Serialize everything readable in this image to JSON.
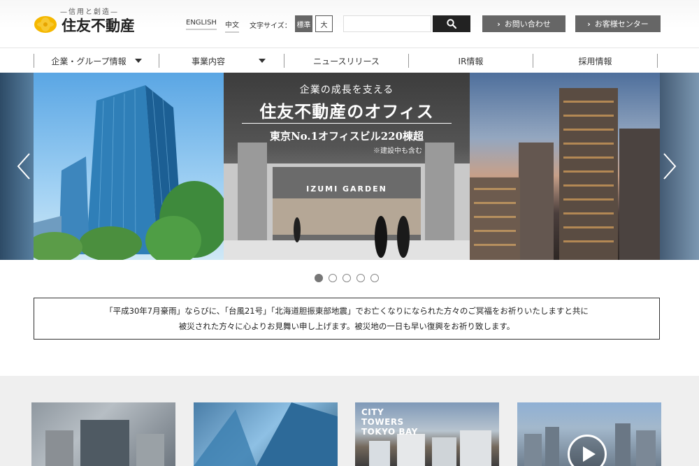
{
  "header": {
    "tagline": "—信用と創造—",
    "logo_text": "住友不動産",
    "lang_en": "ENGLISH",
    "lang_zh": "中文",
    "font_size_label": "文字サイズ：",
    "font_size_standard": "標準",
    "font_size_large": "大",
    "search_placeholder": "",
    "contact_label": "お問い合わせ",
    "customer_center_label": "お客様センター"
  },
  "nav": {
    "items": [
      {
        "label": "企業・グループ情報"
      },
      {
        "label": "事業内容"
      },
      {
        "label": "ニュースリリース"
      },
      {
        "label": "IR情報"
      },
      {
        "label": "採用情報"
      }
    ]
  },
  "hero": {
    "tagline": "企業の成長を支える",
    "title": "住友不動産のオフィス",
    "subtitle": "東京No.1オフィスビル220棟超",
    "note": "※建設中も含む",
    "building_sign": "IZUMI GARDEN",
    "active_slide": 1,
    "slide_count": 5
  },
  "notice": {
    "line1": "「平成30年7月豪雨」ならびに、「台風21号」「北海道胆振東部地震」でお亡くなりになられた方々のご冥福をお祈りいたしますと共に",
    "line2": "被災された方々に心よりお見舞い申し上げます。被災地の一日も早い復興をお祈り致します。"
  },
  "cards": {
    "card3_text": "CITY\nTOWERS\nTOKYO BAY"
  },
  "colors": {
    "logo_yellow": "#f5b800",
    "button_gray": "#666666",
    "search_button": "#222222"
  }
}
